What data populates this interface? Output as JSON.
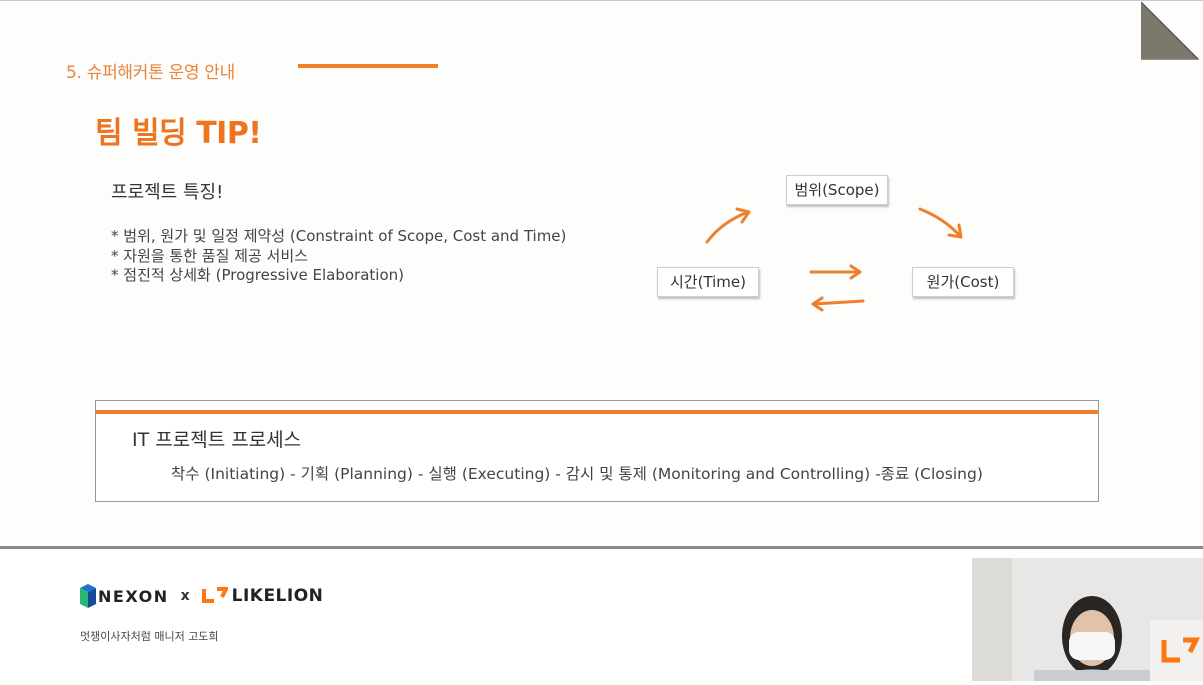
{
  "slide": {
    "section_title": "5. 슈퍼해커톤 운영 안내",
    "main_title": "팀 빌딩 TIP!",
    "features_heading": "프로젝트 특징!",
    "bullets": [
      "* 범위, 원가 및 일정 제약성 (Constraint of Scope, Cost and Time)",
      "* 자원을 통한 품질 제공 서비스",
      "* 점진적 상세화 (Progressive Elaboration)"
    ],
    "diagram": {
      "scope": "범위(Scope)",
      "time": "시간(Time)",
      "cost": "원가(Cost)"
    },
    "process": {
      "title": "IT 프로젝트 프로세스",
      "steps": "착수 (Initiating) - 기획 (Planning) - 실행 (Executing) - 감시 및 통제 (Monitoring and Controlling) -종료 (Closing)"
    }
  },
  "footer": {
    "brand_left": "NEXON",
    "separator": "x",
    "brand_right": "LIKELION",
    "presenter": "멋쟁이사자처럼 매니저 고도희"
  },
  "colors": {
    "accent": "#ef7f2b",
    "title_orange": "#ef7420",
    "corner_gray": "#7d786e"
  },
  "icons": [
    "corner-fold-icon",
    "nexon-logo-icon",
    "likelion-logo-icon",
    "arrow-icon"
  ]
}
